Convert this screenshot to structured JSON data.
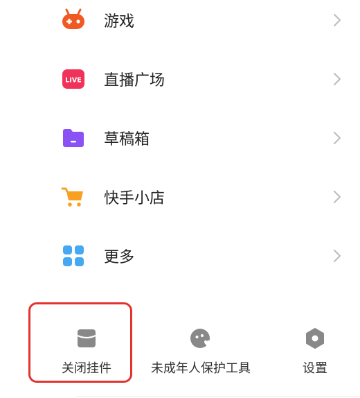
{
  "menu": {
    "items": [
      {
        "label": "游戏",
        "icon": "game-controller-icon",
        "color": "#f05a22"
      },
      {
        "label": "直播广场",
        "icon": "live-icon",
        "color": "#f0325a",
        "badge": "LIVE"
      },
      {
        "label": "草稿箱",
        "icon": "folder-icon",
        "color": "#8a52f5"
      },
      {
        "label": "快手小店",
        "icon": "shopping-cart-icon",
        "color": "#f8a020"
      },
      {
        "label": "更多",
        "icon": "grid-icon",
        "color": "#45a8f2"
      }
    ],
    "chevron_color": "#bbbbbb"
  },
  "bottom_bar": {
    "items": [
      {
        "label": "关闭挂件",
        "icon": "widget-box-icon"
      },
      {
        "label": "未成年人保护工具",
        "icon": "child-protection-icon"
      },
      {
        "label": "设置",
        "icon": "settings-hexagon-icon"
      }
    ],
    "icon_color": "#888888",
    "highlight_color": "#e2332f"
  }
}
